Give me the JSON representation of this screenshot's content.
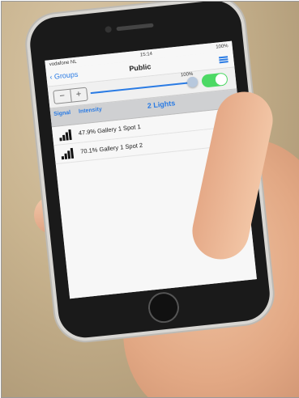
{
  "status_bar": {
    "carrier": "vodafone NL",
    "time": "15:14",
    "battery": "100%"
  },
  "navbar": {
    "back_label": "Groups",
    "title": "Public"
  },
  "controls": {
    "minus_label": "−",
    "plus_label": "+",
    "brightness_percent": "100%",
    "slider_value": 1.0,
    "power_on": true
  },
  "tabs": {
    "signal_label": "Signal",
    "intensity_label": "Intensity",
    "lights_count": "2 Lights"
  },
  "lights": [
    {
      "intensity": "47.9%",
      "name": "Gallery 1 Spot 1"
    },
    {
      "intensity": "70.1%",
      "name": "Gallery 1 Spot 2"
    }
  ],
  "colors": {
    "accent": "#2a7be4",
    "toggle_on": "#4cd964"
  }
}
